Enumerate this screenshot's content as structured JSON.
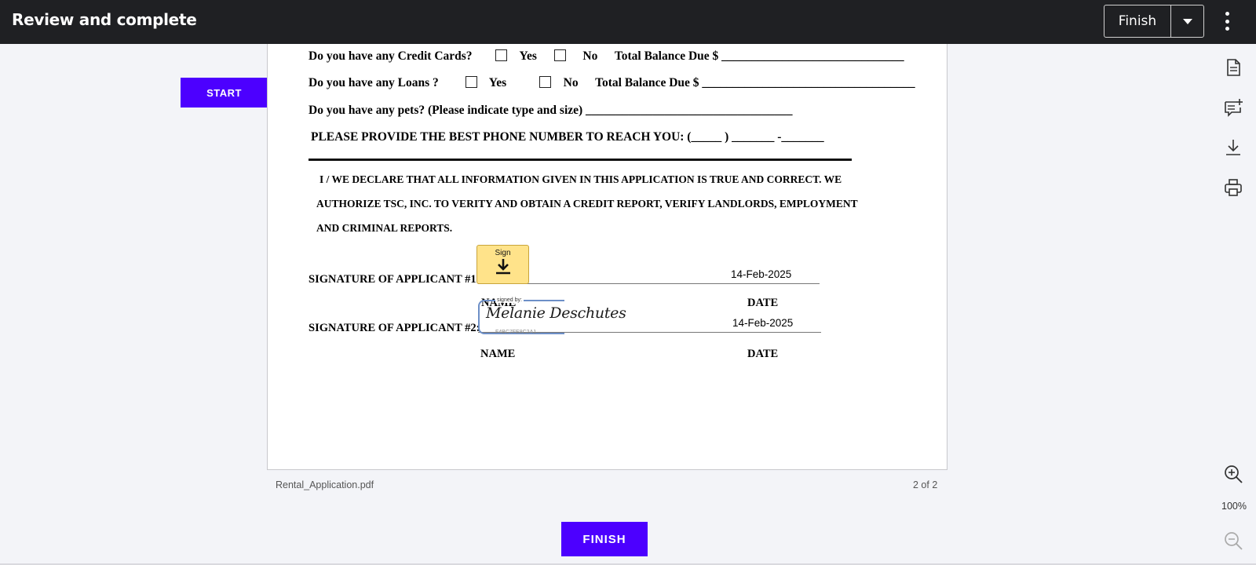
{
  "header": {
    "title": "Review and complete",
    "finish_label": "Finish"
  },
  "start_button": "START",
  "document": {
    "credit_cards": {
      "question": "Do you have any Credit Cards?",
      "yes": "Yes",
      "no": "No",
      "balance": "Total Balance Due $ ______________________________"
    },
    "loans": {
      "question": "Do you have any Loans ?",
      "yes": "Yes",
      "no": "No",
      "balance": "Total Balance Due $ ___________________________________"
    },
    "pets": "Do you have any pets? (Please indicate type and size) __________________________________",
    "phone": "PLEASE PROVIDE THE BEST PHONE NUMBER TO REACH YOU: (_____ ) _______ -_______",
    "declaration": [
      "I / WE DECLARE THAT ALL INFORMATION GIVEN IN THIS APPLICATION IS TRUE AND CORRECT.  WE",
      "AUTHORIZE TSC, INC. TO VERITY AND OBTAIN A CREDIT REPORT, VERIFY LANDLORDS, EMPLOYMENT",
      "AND CRIMINAL REPORTS."
    ],
    "applicant1": {
      "label": "SIGNATURE OF APPLICANT #1:",
      "date": "14-Feb-2025",
      "sign_tag": "Sign"
    },
    "applicant2": {
      "label": "SIGNATURE OF APPLICANT #2:",
      "date": "14-Feb-2025",
      "signed_by": "signed by:",
      "signature": "Melanie Deschutes",
      "sign_id": "F4BC7FE8C2A1..."
    },
    "name_label": "NAME",
    "date_label": "DATE"
  },
  "footer": {
    "file_name": "Rental_Application.pdf",
    "page_count": "2 of 2",
    "finish_label": "FINISH"
  },
  "sidebar": {
    "icons": [
      "document-icon",
      "add-comment-icon",
      "download-icon",
      "print-icon"
    ],
    "zoom_level": "100%"
  },
  "colors": {
    "topbar": "#1f2023",
    "accent": "#4c00ff",
    "sign_tag": "#ffe38a"
  }
}
